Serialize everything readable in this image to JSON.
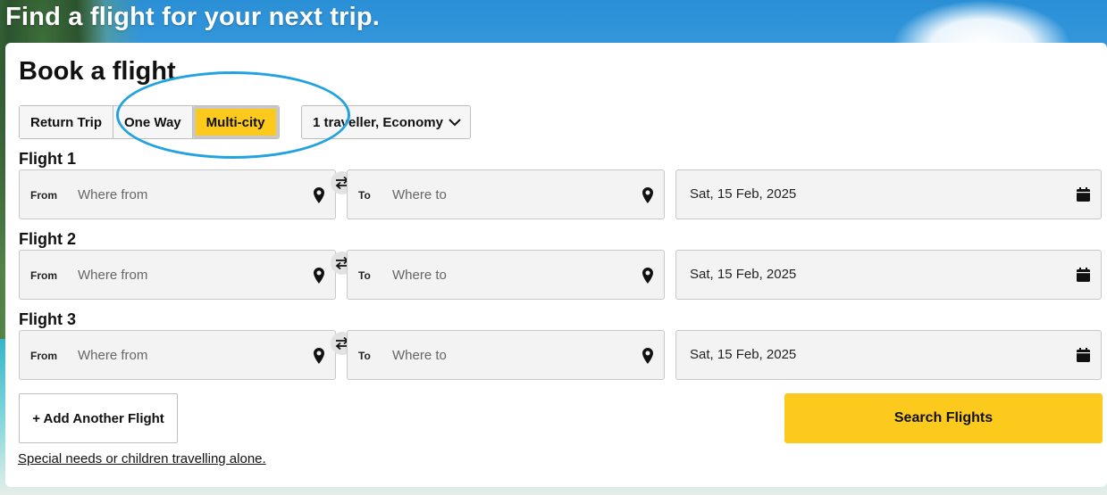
{
  "hero": {
    "title": "Find a flight for your next trip."
  },
  "card": {
    "title": "Book a flight"
  },
  "trip_types": [
    {
      "label": "Return Trip",
      "active": false
    },
    {
      "label": "One Way",
      "active": false
    },
    {
      "label": "Multi-city",
      "active": true
    }
  ],
  "travellers": {
    "label": "1 traveller, Economy"
  },
  "flights": [
    {
      "label": "Flight 1",
      "from_tag": "From",
      "from_placeholder": "Where from",
      "to_tag": "To",
      "to_placeholder": "Where to",
      "date": "Sat, 15 Feb, 2025"
    },
    {
      "label": "Flight 2",
      "from_tag": "From",
      "from_placeholder": "Where from",
      "to_tag": "To",
      "to_placeholder": "Where to",
      "date": "Sat, 15 Feb, 2025"
    },
    {
      "label": "Flight 3",
      "from_tag": "From",
      "from_placeholder": "Where from",
      "to_tag": "To",
      "to_placeholder": "Where to",
      "date": "Sat, 15 Feb, 2025"
    }
  ],
  "actions": {
    "add_flight": "+ Add Another Flight",
    "search": "Search Flights",
    "special_needs": "Special needs or children travelling alone."
  },
  "colors": {
    "accent": "#fcc91d",
    "highlight": "#22a2e0"
  },
  "icons": {
    "location": "map-pin-icon",
    "calendar": "calendar-icon",
    "swap": "swap-arrows-icon",
    "dropdown": "chevron-down-icon"
  }
}
